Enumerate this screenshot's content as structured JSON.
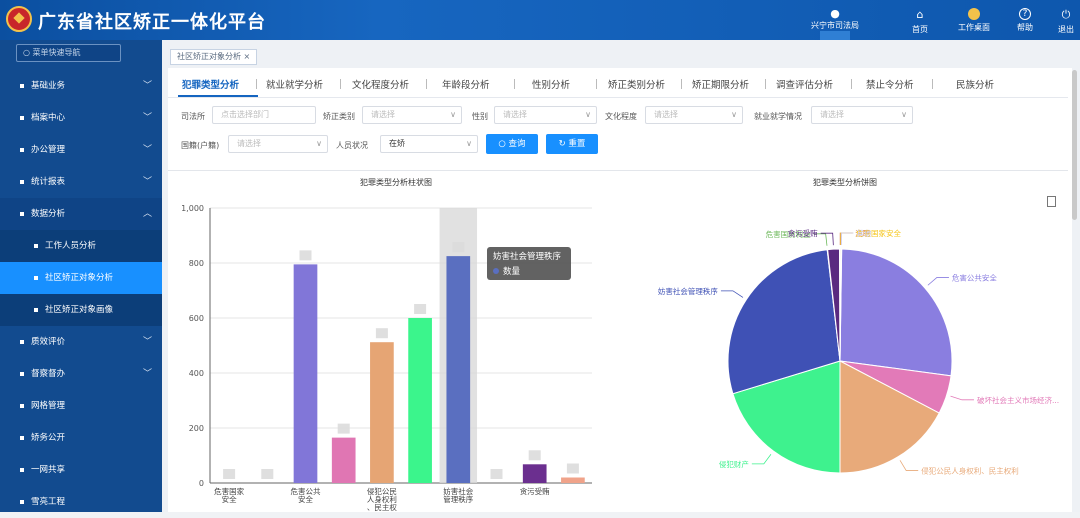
{
  "header": {
    "title": "广东省社区矫正一体化平台",
    "user_org": "兴宁市司法局",
    "home_label": "首页",
    "desk_label": "工作桌面",
    "help_label": "帮助",
    "logout_label": "退出"
  },
  "sidebar": {
    "search_placeholder": "菜单快速导航",
    "items": [
      {
        "label": "基础业务"
      },
      {
        "label": "档案中心"
      },
      {
        "label": "办公管理"
      },
      {
        "label": "统计报表"
      },
      {
        "label": "数据分析"
      },
      {
        "label": "工作人员分析"
      },
      {
        "label": "社区矫正对象分析"
      },
      {
        "label": "社区矫正对象画像"
      },
      {
        "label": "质效评价"
      },
      {
        "label": "督察督办"
      },
      {
        "label": "网格管理"
      },
      {
        "label": "矫务公开"
      },
      {
        "label": "一网共享"
      },
      {
        "label": "雪亮工程"
      }
    ]
  },
  "tagbar": {
    "label": "社区矫正对象分析 ×"
  },
  "tabs": [
    "犯罪类型分析",
    "就业就学分析",
    "文化程度分析",
    "年龄段分析",
    "性别分析",
    "矫正类别分析",
    "矫正期限分析",
    "调查评估分析",
    "禁止令分析",
    "民族分析"
  ],
  "filters": {
    "judicial_label": "司法所",
    "judicial_placeholder": "点击选择部门",
    "category_label": "矫正类别",
    "category_placeholder": "请选择",
    "gender_label": "性别",
    "gender_placeholder": "请选择",
    "edu_label": "文化程度",
    "edu_placeholder": "请选择",
    "job_label": "就业就学情况",
    "job_placeholder": "请选择",
    "nation_label": "国籍(户籍)",
    "nation_placeholder": "请选择",
    "status_label": "人员状况",
    "status_value": "在矫",
    "query_label": "查询",
    "reset_label": "重置"
  },
  "charts_meta": {
    "bar_title": "犯罪类型分析柱状图",
    "pie_title": "犯罪类型分析饼图",
    "tooltip_title": "妨害社会管理秩序",
    "tooltip_series": "数量"
  },
  "chart_data": [
    {
      "type": "bar",
      "title": "犯罪类型分析柱状图",
      "categories": [
        "危害国家安全",
        "",
        "危害公共安全",
        "破坏社会主义市场经济秩序",
        "侵犯公民人身权利、民主权利",
        "侵犯财产",
        "妨害社会管理秩序",
        "",
        "贪污受贿",
        ""
      ],
      "tick_labels": [
        "危害国家安全",
        "危害公共安全",
        "侵犯公民人身权利、民主权利",
        "妨害社会管理秩序",
        "贪污受贿"
      ],
      "values": [
        0,
        0,
        795,
        165,
        512,
        600,
        825,
        0,
        68,
        20
      ],
      "colors": [
        "#cccccc",
        "#cccccc",
        "#8176d8",
        "#e076b3",
        "#e6a574",
        "#3bf58c",
        "#5a6fc0",
        "#cccccc",
        "#6b2f8f",
        "#f0a38a"
      ],
      "ylim": [
        0,
        1000
      ],
      "yticks": [
        0,
        200,
        400,
        600,
        800,
        1000
      ],
      "highlight_index": 6
    },
    {
      "type": "pie",
      "title": "犯罪类型分析饼图",
      "labels": [
        "危害公共安全",
        "破坏社会主义市场经济...",
        "侵犯公民人身权利、民主权利",
        "侵犯财产",
        "妨害社会管理秩序",
        "危害国防利益",
        "贪污受贿",
        "渎职",
        "危害国家安全",
        "其他"
      ],
      "values": [
        795,
        165,
        512,
        600,
        825,
        2,
        50,
        5,
        1,
        3
      ],
      "colors": [
        "#8a7ee0",
        "#e27ab8",
        "#e8aa7a",
        "#3ef28e",
        "#3f51b5",
        "#6cb85a",
        "#5a2a80",
        "#e0956a",
        "#f5c518",
        "#c9c9f2"
      ]
    }
  ]
}
